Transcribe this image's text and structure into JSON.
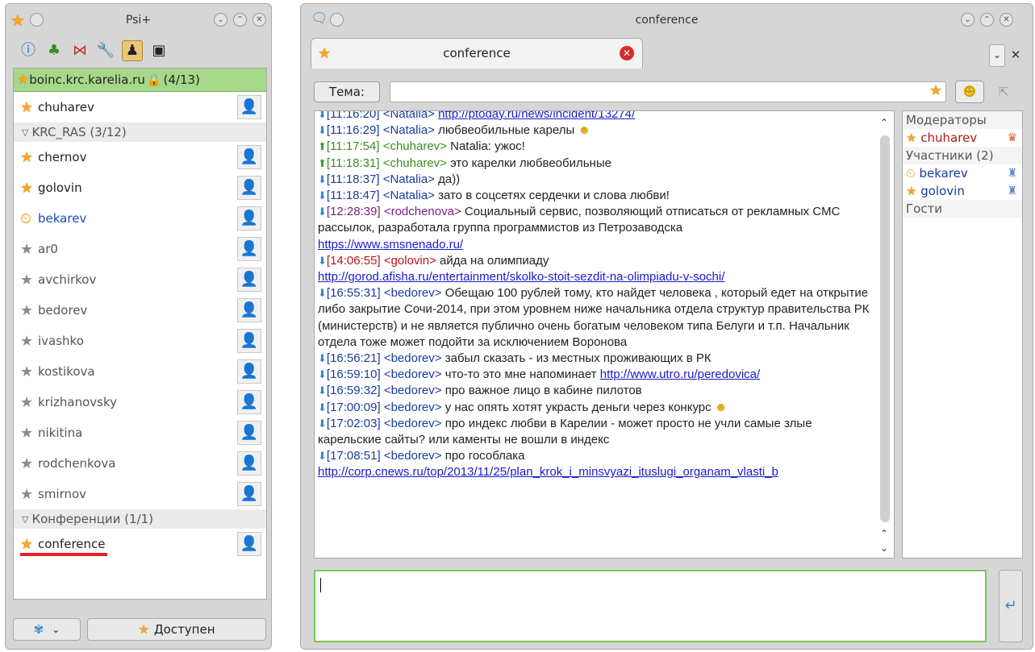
{
  "roster_window": {
    "title": "Psi+",
    "account": {
      "name": "boinc.krc.karelia.ru",
      "count": "(4/13)"
    },
    "top_contact": "chuharev",
    "group1": {
      "label": "KRC_RAS (3/12)"
    },
    "contacts": [
      {
        "name": "chernov",
        "status": "online"
      },
      {
        "name": "golovin",
        "status": "online"
      },
      {
        "name": "bekarev",
        "status": "away"
      },
      {
        "name": "ar0",
        "status": "offline"
      },
      {
        "name": "avchirkov",
        "status": "offline"
      },
      {
        "name": "bedorev",
        "status": "offline"
      },
      {
        "name": "ivashko",
        "status": "offline"
      },
      {
        "name": "kostikova",
        "status": "offline"
      },
      {
        "name": "krizhanovsky",
        "status": "offline"
      },
      {
        "name": "nikitina",
        "status": "offline"
      },
      {
        "name": "rodchenkova",
        "status": "offline"
      },
      {
        "name": "smirnov",
        "status": "offline"
      }
    ],
    "group2": {
      "label": "Конференции (1/1)"
    },
    "conference_contact": "conference",
    "status_button": "Доступен"
  },
  "chat_window": {
    "title": "conference",
    "tab_label": "conference",
    "topic_button": "Тема:",
    "messages": [
      {
        "time": "[11:16:20]",
        "nick": "<Natalia>",
        "dir": "in",
        "text": "",
        "link": "http://ptoday.ru/news/incident/13274/"
      },
      {
        "time": "[11:16:29]",
        "nick": "<Natalia>",
        "dir": "in",
        "text": "любвеобильные карелы",
        "smile": true
      },
      {
        "time": "[11:17:54]",
        "nick": "<chuharev>",
        "dir": "out",
        "text": "Natalia: ужос!"
      },
      {
        "time": "[11:18:31]",
        "nick": "<chuharev>",
        "dir": "out",
        "text": "это карелки любвеобильные"
      },
      {
        "time": "[11:18:37]",
        "nick": "<Natalia>",
        "dir": "in",
        "text": "да))"
      },
      {
        "time": "[11:18:47]",
        "nick": "<Natalia>",
        "dir": "in",
        "text": "зато в соцсетях сердечки и слова любви!"
      },
      {
        "time": "[12:28:39]",
        "nick": "<rodchenova>",
        "dir": "in",
        "color": "purple",
        "text": "Социальный сервис, позволяющий отписаться от рекламных СМС рассылок, разработала группа программистов из Петрозаводска",
        "link": "https://www.smsnenado.ru/"
      },
      {
        "time": "[14:06:55]",
        "nick": "<golovin>",
        "dir": "in",
        "color": "red",
        "text": "айда на олимпиаду",
        "link": "http://gorod.afisha.ru/entertainment/skolko-stoit-sezdit-na-olimpiadu-v-sochi/"
      },
      {
        "time": "[16:55:31]",
        "nick": "<bedorev>",
        "dir": "in",
        "text": "Обещаю 100 рублей тому, кто найдет человека , который едет на открытие либо закрытие Сочи-2014,  при этом уровнем ниже начальника отдела структур правительства РК (министерств) и не является публично очень богатым человеком типа Белуги и т.п. Начальник отдела тоже может подойти за исключением Воронова"
      },
      {
        "time": "[16:56:21]",
        "nick": "<bedorev>",
        "dir": "in",
        "text": "забыл сказать - из местных проживающих в РК"
      },
      {
        "time": "[16:59:10]",
        "nick": "<bedorev>",
        "dir": "in",
        "text": "что-то это мне напоминает",
        "link": "http://www.utro.ru/peredovica/"
      },
      {
        "time": "[16:59:32]",
        "nick": "<bedorev>",
        "dir": "in",
        "text": "про важное лицо в кабине пилотов"
      },
      {
        "time": "[17:00:09]",
        "nick": "<bedorev>",
        "dir": "in",
        "text": "у нас опять хотят украсть деньги через конкурс",
        "smile": true
      },
      {
        "time": "[17:02:03]",
        "nick": "<bedorev>",
        "dir": "in",
        "text": "про индекс любви в Карелии - может просто не учли самые злые карельские сайты?  или каменты не вошли в индекс"
      },
      {
        "time": "[17:08:51]",
        "nick": "<bedorev>",
        "dir": "in",
        "text": "про гособлака",
        "link": "http://corp.cnews.ru/top/2013/11/25/plan_krok_i_minsvyazi_ituslugi_organam_vlasti_b"
      }
    ],
    "occupants": {
      "moderators_label": "Модераторы",
      "moderators": [
        "chuharev"
      ],
      "participants_label": "Участники (2)",
      "participants": [
        "bekarev",
        "golovin"
      ],
      "guests_label": "Гости"
    }
  }
}
